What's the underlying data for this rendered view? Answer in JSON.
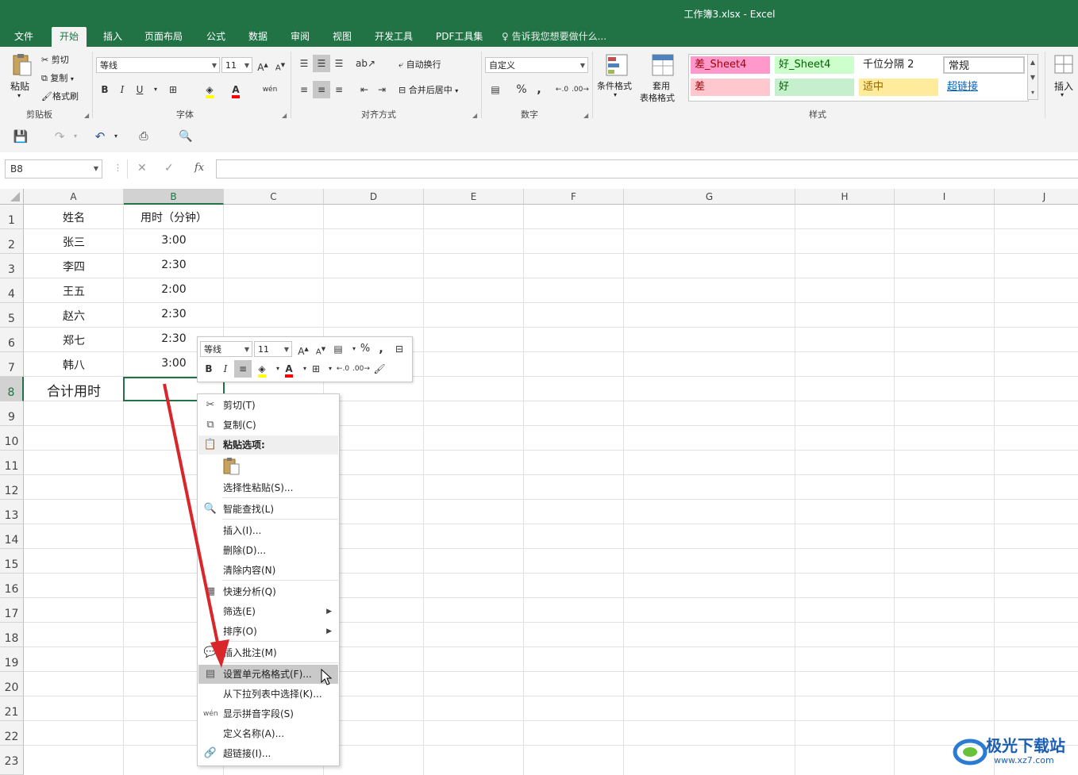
{
  "window": {
    "title": "工作簿3.xlsx - Excel"
  },
  "tabs": [
    "文件",
    "开始",
    "插入",
    "页面布局",
    "公式",
    "数据",
    "审阅",
    "视图",
    "开发工具",
    "PDF工具集"
  ],
  "active_tab": "开始",
  "tell_me": "告诉我您想要做什么...",
  "ribbon": {
    "clipboard": {
      "paste": "粘贴",
      "cut": "剪切",
      "copy": "复制",
      "format_painter": "格式刷",
      "label": "剪贴板"
    },
    "font": {
      "name": "等线",
      "size": "11",
      "label": "字体",
      "bold": "B",
      "italic": "I",
      "underline": "U"
    },
    "alignment": {
      "wrap": "自动换行",
      "merge": "合并后居中",
      "label": "对齐方式"
    },
    "number": {
      "format": "自定义",
      "percent": "%",
      "comma": ",",
      "label": "数字"
    },
    "styles": {
      "conditional": "条件格式",
      "table_format_1": "套用",
      "table_format_2": "表格格式",
      "cells": [
        {
          "text": "差_Sheet4",
          "bg": "#ff99cc",
          "fg": "#9c0006"
        },
        {
          "text": "好_Sheet4",
          "bg": "#ccffcc",
          "fg": "#006100"
        },
        {
          "text": "千位分隔 2",
          "bg": "#ffffff",
          "fg": "#222222"
        },
        {
          "text": "常规",
          "bg": "#ffffff",
          "fg": "#222222"
        },
        {
          "text": "差",
          "bg": "#ffc7ce",
          "fg": "#9c0006"
        },
        {
          "text": "好",
          "bg": "#c6efce",
          "fg": "#006100"
        },
        {
          "text": "适中",
          "bg": "#ffeb9c",
          "fg": "#9c6500"
        },
        {
          "text": "超链接",
          "bg": "#ffffff",
          "fg": "#0563c1"
        }
      ],
      "label": "样式"
    },
    "insert": "插入"
  },
  "formula_bar": {
    "name_box": "B8",
    "fx": "fx",
    "value": ""
  },
  "sheet": {
    "columns": [
      "A",
      "B",
      "C",
      "D",
      "E",
      "F",
      "G",
      "H",
      "I",
      "J"
    ],
    "rows": [
      "1",
      "2",
      "3",
      "4",
      "5",
      "6",
      "7",
      "8",
      "9",
      "10",
      "11",
      "12",
      "13",
      "14",
      "15",
      "16",
      "17",
      "18",
      "19",
      "20",
      "21",
      "22",
      "23"
    ],
    "data": [
      [
        "姓名",
        "用时（分钟）"
      ],
      [
        "张三",
        "3:00"
      ],
      [
        "李四",
        "2:30"
      ],
      [
        "王五",
        "2:00"
      ],
      [
        "赵六",
        "2:30"
      ],
      [
        "郑七",
        "2:30"
      ],
      [
        "韩八",
        "3:00"
      ],
      [
        "合计用时",
        ""
      ]
    ],
    "active_cell": "B8"
  },
  "mini_toolbar": {
    "font": "等线",
    "size": "11"
  },
  "context_menu": {
    "items": [
      {
        "label": "剪切(T)",
        "icon": "scissors-icon"
      },
      {
        "label": "复制(C)",
        "icon": "copy-icon"
      },
      {
        "label": "粘贴选项:",
        "icon": "paste-icon"
      },
      {
        "label": "选择性粘贴(S)...",
        "icon": ""
      },
      {
        "label": "智能查找(L)",
        "icon": "smart-lookup-icon"
      },
      {
        "label": "插入(I)...",
        "icon": ""
      },
      {
        "label": "删除(D)...",
        "icon": ""
      },
      {
        "label": "清除内容(N)",
        "icon": ""
      },
      {
        "label": "快速分析(Q)",
        "icon": "quick-analysis-icon"
      },
      {
        "label": "筛选(E)",
        "icon": ""
      },
      {
        "label": "排序(O)",
        "icon": ""
      },
      {
        "label": "插入批注(M)",
        "icon": "comment-icon"
      },
      {
        "label": "设置单元格格式(F)...",
        "icon": "format-cells-icon"
      },
      {
        "label": "从下拉列表中选择(K)...",
        "icon": ""
      },
      {
        "label": "显示拼音字段(S)",
        "icon": "phonetic-icon"
      },
      {
        "label": "定义名称(A)...",
        "icon": ""
      },
      {
        "label": "超链接(I)...",
        "icon": "hyperlink-icon"
      }
    ],
    "highlighted": "设置单元格格式(F)..."
  },
  "watermark": {
    "text": "极光下载站",
    "url": "www.xz7.com"
  },
  "colors": {
    "accent": "#217346",
    "arrow": "#d9262a"
  }
}
